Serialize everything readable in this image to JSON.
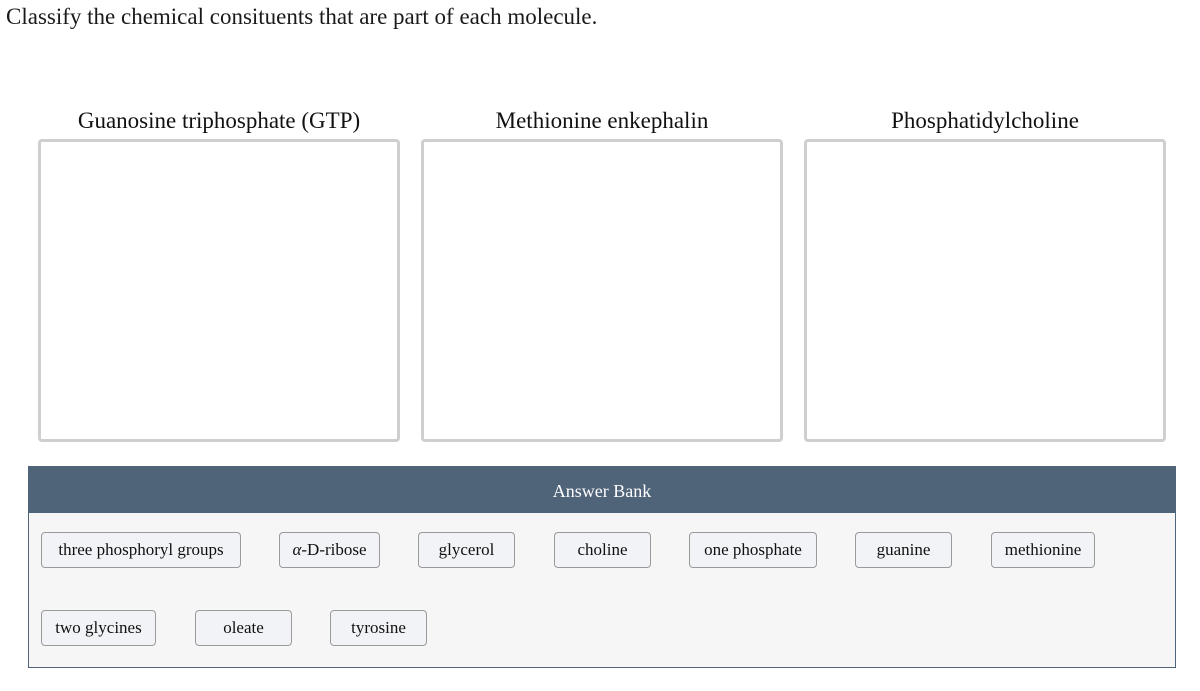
{
  "prompt": "Classify the chemical consituents that are part of each molecule.",
  "drop_zones": [
    {
      "title": "Guanosine triphosphate (GTP)",
      "items": []
    },
    {
      "title": "Methionine enkephalin",
      "items": []
    },
    {
      "title": "Phosphatidylcholine",
      "items": []
    }
  ],
  "answer_bank": {
    "title": "Answer Bank",
    "items": [
      {
        "prefix": "",
        "label": "three phosphoryl groups"
      },
      {
        "prefix": "α",
        "label": "-D-ribose"
      },
      {
        "prefix": "",
        "label": "glycerol"
      },
      {
        "prefix": "",
        "label": "choline"
      },
      {
        "prefix": "",
        "label": "one phosphate"
      },
      {
        "prefix": "",
        "label": "guanine"
      },
      {
        "prefix": "",
        "label": "methionine"
      },
      {
        "prefix": "",
        "label": "two glycines"
      },
      {
        "prefix": "",
        "label": "oleate"
      },
      {
        "prefix": "",
        "label": "tyrosine"
      }
    ]
  }
}
